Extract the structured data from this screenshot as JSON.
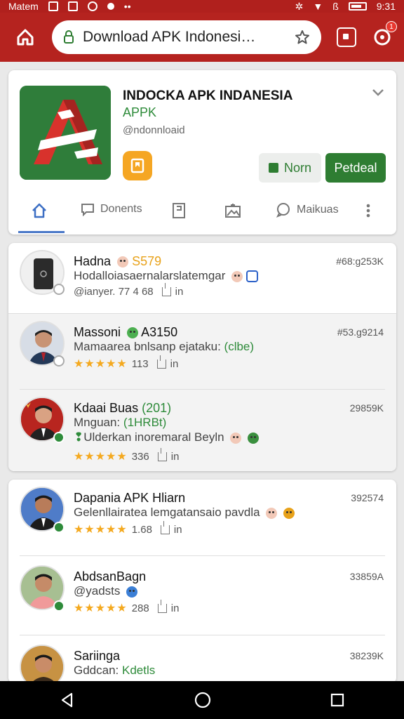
{
  "status_bar": {
    "carrier": "Matem",
    "time": "9:31",
    "signal_text": "ß"
  },
  "browser": {
    "url": "Download APK Indonesi…",
    "notif_count": "1"
  },
  "app": {
    "title": "INDOCKA APK INDANESIA",
    "subtitle": "APPK",
    "handle": "@ndonnloaid",
    "btn_secondary": "Norn",
    "btn_primary": "Petdeal",
    "tabs": [
      {
        "label": ""
      },
      {
        "label": "Donents"
      },
      {
        "label": ""
      },
      {
        "label": ""
      },
      {
        "label": "Maikuas"
      }
    ]
  },
  "list_one": [
    {
      "name": "Hadna",
      "tag": "S579",
      "desc": "Hodalloiasaernalarslatemgar",
      "meta": "@ianyer. 77 4 68",
      "meta_suffix": "in",
      "id": "#68:g253K"
    },
    {
      "name": "Massoni",
      "tag": "A3150",
      "desc": "Mamaarea bnlsanp ejataku:",
      "desc_tag": "(clbe)",
      "rating": "113",
      "meta_suffix": "in",
      "id": "#53.g9214"
    },
    {
      "name": "Kdaai Buas",
      "tag": "(201)",
      "desc": "Mnguan:",
      "desc_tag": "(1HRBt)",
      "desc2": "Ulderkan inoremaral Beyln",
      "rating": "336",
      "meta_suffix": "in",
      "id": "29859K"
    }
  ],
  "list_two": [
    {
      "name": "Dapania APK Hliarn",
      "desc": "Gelenllairatea lemgatansaio pavdla",
      "rating": "1.68",
      "meta_suffix": "in",
      "id": "392574"
    },
    {
      "name": "AbdsanBagn",
      "desc": "@yadsts",
      "rating": "288",
      "meta_suffix": "in",
      "id": "33859A"
    },
    {
      "name": "Sariinga",
      "desc": "Gddcan:",
      "desc_tag": "Kdetls",
      "id": "38239K"
    }
  ],
  "stars": "★★★★★",
  "colors": {
    "brand_red": "#b5231f",
    "green": "#2e7d32",
    "star": "#f4a91f"
  }
}
